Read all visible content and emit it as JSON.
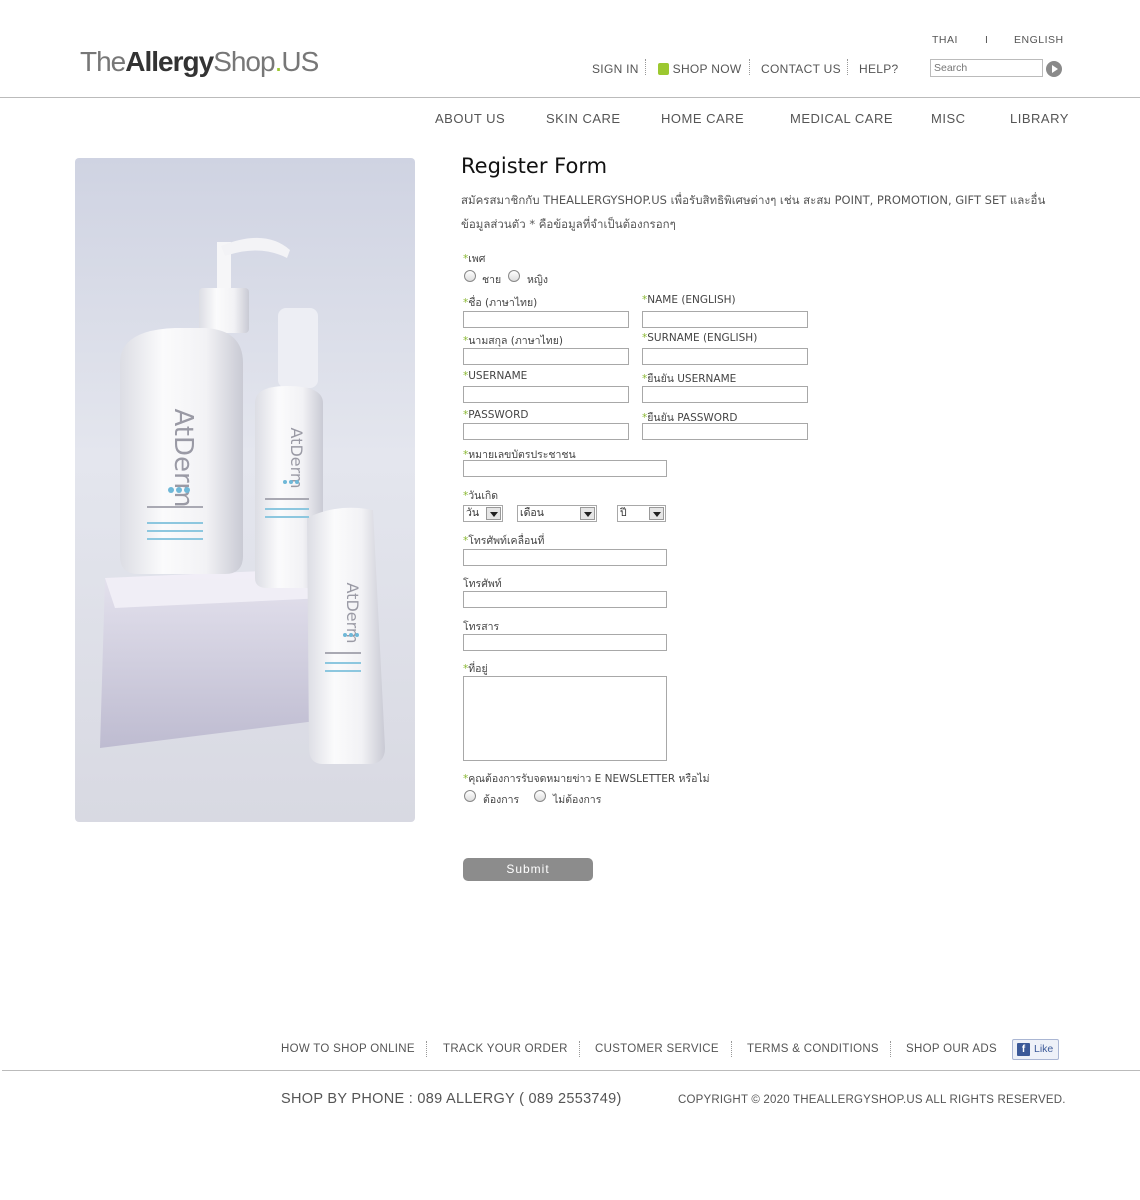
{
  "header": {
    "logo": {
      "part1": "The",
      "part2": "Allergy",
      "part3": "Shop",
      "part4": ".",
      "part5": "US"
    },
    "lang": {
      "thai": "THAI",
      "sep": "I",
      "english": "ENGLISH"
    },
    "topnav": {
      "sign_in": "SIGN IN",
      "shop_now": "SHOP NOW",
      "contact_us": "CONTACT US",
      "help": "HELP?"
    },
    "search": {
      "placeholder": "Search"
    }
  },
  "mainnav": [
    "ABOUT US",
    "SKIN CARE",
    "HOME CARE",
    "MEDICAL CARE",
    "MISC",
    "LIBRARY"
  ],
  "product_image": {
    "alt": "AtDerm products",
    "brand": "AtDerm"
  },
  "form": {
    "title": "Register Form",
    "intro1": "สมัครสมาชิกกับ THEALLERGYSHOP.US เพื่อรับสิทธิพิเศษต่างๆ เช่น สะสม POINT, PROMOTION, GIFT SET และอื่น",
    "intro2": "ข้อมูลส่วนตัว    *  คือข้อมูลที่จำเป็นต้องกรอกๆ",
    "required_mark": "*",
    "gender_label": "เพศ",
    "gender_male": "ชาย",
    "gender_female": "หญิง",
    "firstname_th": "ชื่อ (ภาษาไทย)",
    "firstname_en": "NAME (ENGLISH)",
    "surname_th": "นามสกุล (ภาษาไทย)",
    "surname_en": "SURNAME (ENGLISH)",
    "username": "USERNAME",
    "username_confirm": "ยืนยัน USERNAME",
    "password": "PASSWORD",
    "password_confirm": "ยืนยัน PASSWORD",
    "id_card": "หมายเลขบัตรประชาชน",
    "birthday": "วันเกิด",
    "day": "วัน",
    "month": "เดือน",
    "year": "ปี",
    "mobile": "โทรศัพท์เคลื่อนที่",
    "phone": "โทรศัพท์",
    "fax": "โทรสาร",
    "address": "ที่อยู่",
    "newsletter": "คุณต้องการรับจดหมายข่าว E NEWSLETTER หรือไม่",
    "newsletter_yes": "ต้องการ",
    "newsletter_no": "ไม่ต้องการ",
    "submit": "Submit"
  },
  "footer": {
    "links": [
      "HOW TO SHOP ONLINE",
      "TRACK YOUR ORDER",
      "CUSTOMER SERVICE",
      "TERMS & CONDITIONS",
      "SHOP OUR ADS"
    ],
    "like": "Like",
    "like_icon": "f",
    "phone": "SHOP BY PHONE : 089 ALLERGY ( 089 2553749)",
    "copyright": "COPYRIGHT © 2020 THEALLERGYSHOP.US  ALL RIGHTS RESERVED."
  }
}
